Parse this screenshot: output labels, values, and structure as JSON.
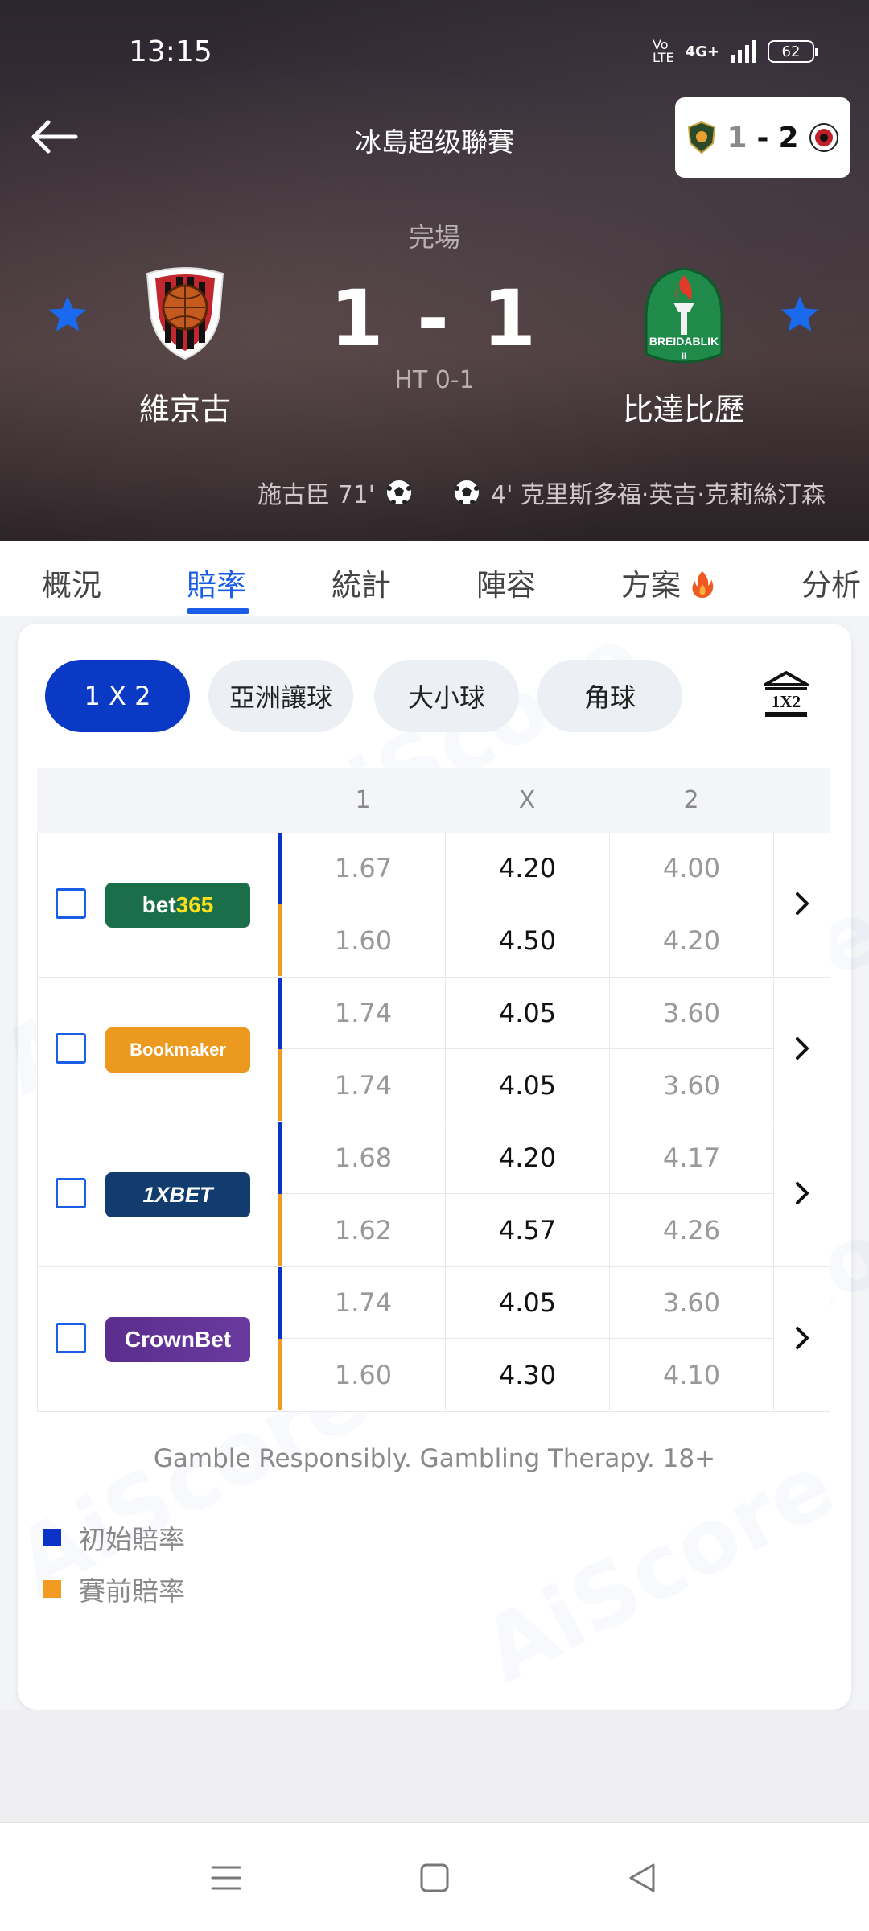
{
  "status_bar": {
    "time": "13:15",
    "network": "4G+",
    "battery": "62"
  },
  "header": {
    "league": "冰島超级聯賽",
    "mini_score": {
      "home": "1",
      "sep": "-",
      "away": "2"
    },
    "match_status": "完場",
    "score": "1 - 1",
    "halftime": "HT 0-1",
    "home_team": "維京古",
    "away_team": "比達比歷",
    "away_logo_text": "BREIDABLIK",
    "home_goal": "施古臣 71'",
    "away_goal": "4' 克里斯多福·英吉·克莉絲汀森"
  },
  "tabs": [
    {
      "label": "概況"
    },
    {
      "label": "賠率"
    },
    {
      "label": "統計"
    },
    {
      "label": "陣容"
    },
    {
      "label": "方案"
    },
    {
      "label": "分析"
    }
  ],
  "market_chips": [
    {
      "label": "1 X 2"
    },
    {
      "label": "亞洲讓球"
    },
    {
      "label": "大小球"
    },
    {
      "label": "角球"
    }
  ],
  "bank_icon_label": "1X2",
  "watermark": "AiScore",
  "odds_table": {
    "headers": [
      "1",
      "X",
      "2"
    ],
    "rows": [
      {
        "bookmaker": "bet365",
        "initial": [
          "1.67",
          "4.20",
          "4.00"
        ],
        "prematch": [
          "1.60",
          "4.50",
          "4.20"
        ]
      },
      {
        "bookmaker": "Bookmaker",
        "initial": [
          "1.74",
          "4.05",
          "3.60"
        ],
        "prematch": [
          "1.74",
          "4.05",
          "3.60"
        ]
      },
      {
        "bookmaker": "1XBET",
        "initial": [
          "1.68",
          "4.20",
          "4.17"
        ],
        "prematch": [
          "1.62",
          "4.57",
          "4.26"
        ]
      },
      {
        "bookmaker": "CrownBet",
        "initial": [
          "1.74",
          "4.05",
          "3.60"
        ],
        "prematch": [
          "1.60",
          "4.30",
          "4.10"
        ]
      }
    ]
  },
  "disclaimer": "Gamble Responsibly. Gambling Therapy. 18+",
  "legend": {
    "initial": "初始賠率",
    "prematch": "賽前賠率"
  },
  "colors": {
    "accent": "#1a5de6",
    "initial": "#0c33c7",
    "prematch": "#f29a21",
    "chip_active": "#0939c5"
  }
}
